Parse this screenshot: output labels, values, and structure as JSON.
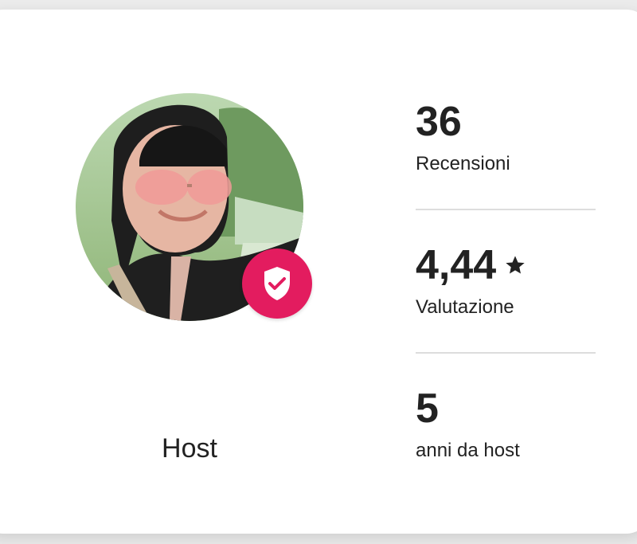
{
  "profile": {
    "role": "Host",
    "verified_badge": "verified-shield-icon"
  },
  "stats": [
    {
      "value": "36",
      "label": "Recensioni"
    },
    {
      "value": "4,44",
      "label": "Valutazione",
      "icon": "star-icon"
    },
    {
      "value": "5",
      "label": "anni da host"
    }
  ],
  "colors": {
    "badge": "#e31c5f",
    "text": "#222222",
    "divider": "#dddddd"
  }
}
